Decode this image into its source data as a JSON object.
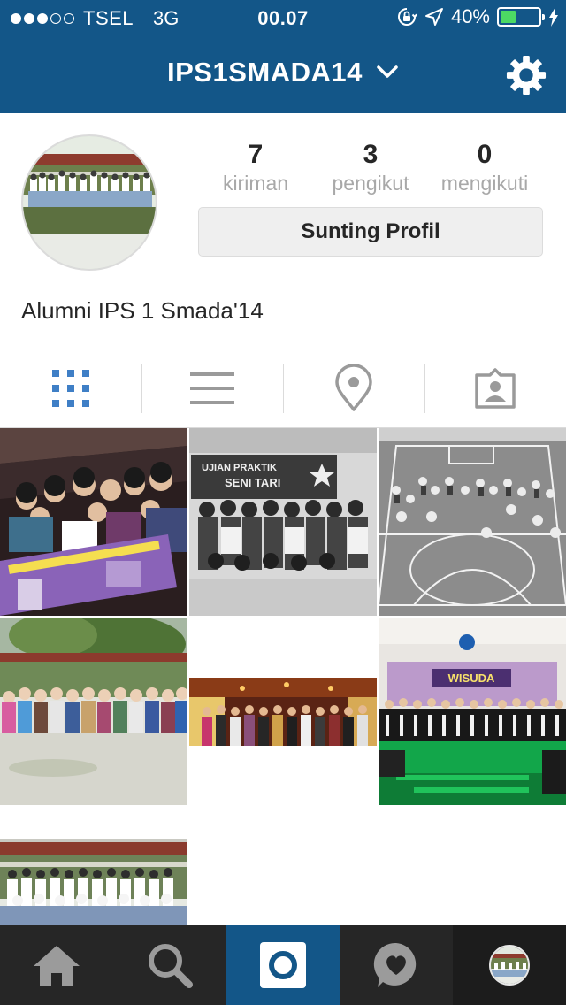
{
  "status_bar": {
    "carrier": "TSEL",
    "network": "3G",
    "time": "00.07",
    "battery": "40%",
    "signal_bars": 3,
    "battery_level": 0.4
  },
  "nav": {
    "title": "IPS1SMADA14"
  },
  "profile": {
    "posts_count": "7",
    "posts_label": "kiriman",
    "followers_count": "3",
    "followers_label": "pengikut",
    "following_count": "0",
    "following_label": "mengikuti",
    "edit_button_label": "Sunting Profil",
    "full_name": "Alumni IPS 1 Smada'14"
  },
  "tabs": [
    "grid-icon",
    "list-icon",
    "location-pin-icon",
    "tagged-photos-icon"
  ],
  "colors": {
    "brand_blue": "#135688",
    "active_tab_icon": "#3f7fc6",
    "inactive_icon": "#9a9a9a",
    "tabbar_bg": "#262626",
    "battery_green": "#4cd964"
  },
  "photos": [
    {
      "name": "photo-group-banner",
      "tone": "color"
    },
    {
      "name": "photo-ujian-praktik",
      "tone": "bw"
    },
    {
      "name": "photo-court-formation",
      "tone": "bw"
    },
    {
      "name": "photo-schoolyard-group",
      "tone": "color"
    },
    {
      "name": "photo-restaurant-group",
      "tone": "color"
    },
    {
      "name": "photo-wisuda-stage",
      "tone": "color"
    },
    {
      "name": "photo-class-photo",
      "tone": "color"
    }
  ],
  "photo_texts": {
    "ujian_line1": "UJIAN PRAKTIK",
    "ujian_line2": "SENI TARI",
    "wisuda": "WISUDA"
  },
  "bottom_bar": [
    "home-icon",
    "search-icon",
    "camera-icon",
    "activity-heart-icon",
    "profile-avatar"
  ]
}
